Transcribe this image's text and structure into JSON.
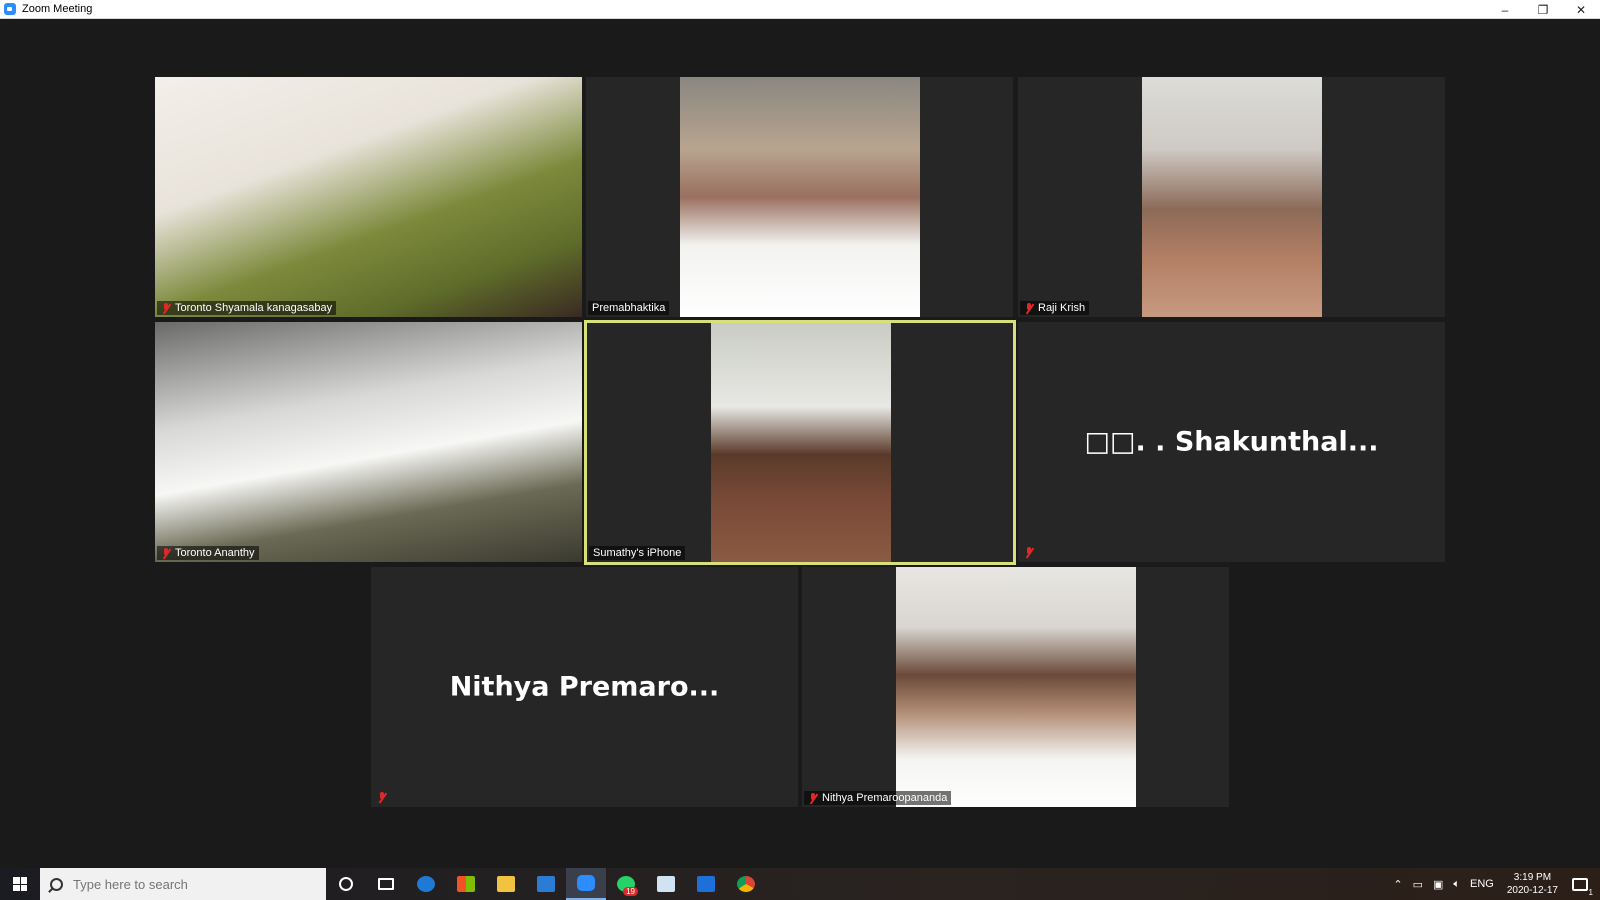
{
  "window": {
    "title": "Zoom Meeting",
    "controls": {
      "minimize": "–",
      "restore": "❐",
      "close": "✕"
    }
  },
  "participants": [
    {
      "name": "Toronto  Shyamala  kanagasabay",
      "muted": true,
      "video": true
    },
    {
      "name": "Premabhaktika",
      "muted": false,
      "video": true
    },
    {
      "name": "Raji Krish",
      "muted": true,
      "video": true
    },
    {
      "name": "Toronto   Ananthy",
      "muted": true,
      "video": true
    },
    {
      "name": "Sumathy's iPhone",
      "muted": false,
      "video": true,
      "active_speaker": true
    },
    {
      "display_name": "□□. . Shakunthal...",
      "muted": true,
      "video": false
    },
    {
      "display_name": "Nithya  Premaro...",
      "muted": true,
      "video": false
    },
    {
      "name": "Nithya Premaroopananda",
      "muted": true,
      "video": true
    }
  ],
  "taskbar": {
    "search_placeholder": "Type here to search",
    "apps": [
      "cortana-icon",
      "task-view-icon",
      "edge-icon",
      "store-icon",
      "file-explorer-icon",
      "mail-icon",
      "zoom-icon",
      "whatsapp-icon",
      "notepad-icon",
      "photos-icon",
      "chrome-icon"
    ],
    "whatsapp_badge": "19",
    "tray": {
      "language": "ENG",
      "time": "3:19 PM",
      "date": "2020-12-17",
      "notifications": "1"
    }
  }
}
